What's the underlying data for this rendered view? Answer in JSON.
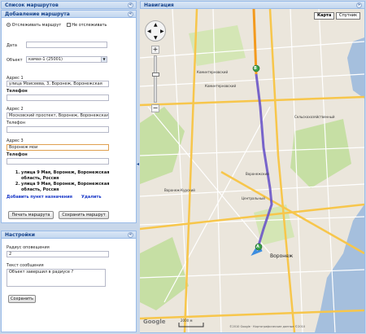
{
  "route_list_panel": {
    "title": "Список маршрутов",
    "tool": "«"
  },
  "add_route_panel": {
    "title": "Добавление маршрута",
    "tool": "«",
    "radio_track": "Отслеживать маршрут",
    "check_no_track": "Не отслеживать",
    "date_label": "Дата",
    "date_value": "",
    "object_label": "Объект",
    "object_value": "камаз-1 (25001)",
    "addr1_label": "Адрес 1",
    "addr1_value": "улица Моисеева, 3, Воронеж, Воронежская",
    "addr1_rel_label": "Телефон",
    "addr1_rel_value": "",
    "addr2_label": "Адрес 2",
    "addr2_value": "Московский проспект, Воронеж, Воронежская",
    "addr2_sub": "Телефон",
    "addr2_extra": "",
    "addr3_label": "Адрес 3",
    "addr3_value": "Воронеж мои",
    "addr3_sub": "Телефон",
    "addr3_extra": "",
    "suggestions": [
      "улица 9 Мая, Воронеж, Воронежская область, Россия",
      "улица 9 Мая, Воронеж, Воронежская область, Россия"
    ],
    "add_point_link": "Добавить пункт назначения",
    "delete_link": "Удалить",
    "print_button": "Печать маршрута",
    "save_button": "Сохранить маршрут"
  },
  "settings_panel": {
    "title": "Настройки",
    "tool": "«",
    "radius_label": "Радиус оповещения",
    "radius_value": "2",
    "message_label": "Текст сообщения",
    "message_value": "Объект завершил в радиусе ?",
    "save_button": "Сохранить"
  },
  "navigation_panel": {
    "title": "Навигация",
    "tool": "»",
    "map_type_map": "Карта",
    "map_type_satellite": "Спутник",
    "zoom_in": "+",
    "zoom_out": "−",
    "city_label": "Воронеж",
    "labels": [
      "Коминтерновский",
      "Коминтерновский",
      "Воронеж-Курский",
      "Центральный",
      "Сельскохозяйственный",
      "Воронежский"
    ],
    "marker_a": "A",
    "marker_b": "B",
    "scale_label": "2000 м",
    "copyright": "©2010 Google · Картографические данные ©2010",
    "logo": "Google"
  },
  "colors": {
    "header_bg": "#c3d7ef",
    "route": "#6a55c8",
    "road_major": "#f7c64b"
  }
}
